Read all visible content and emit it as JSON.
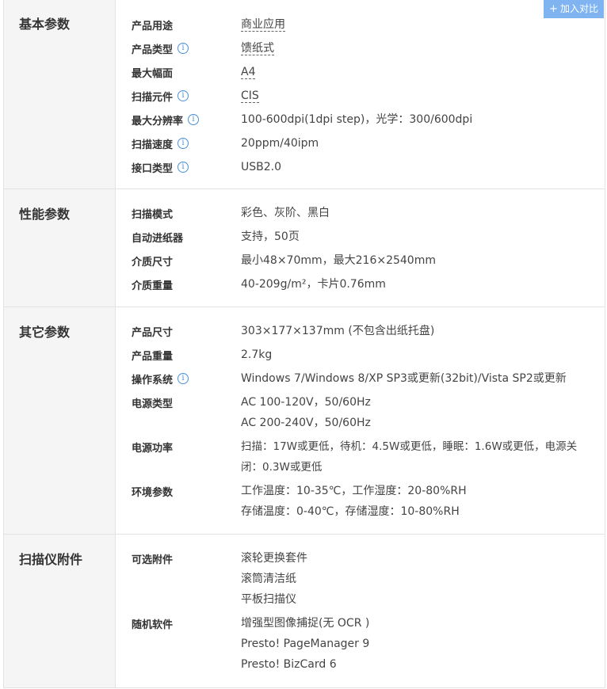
{
  "compare_button": {
    "icon": "+",
    "label": "加入对比"
  },
  "sections": [
    {
      "title": "基本参数",
      "rows": [
        {
          "label": "产品用途",
          "info": false,
          "lines": [
            "商业应用"
          ],
          "dashed": true
        },
        {
          "label": "产品类型",
          "info": true,
          "lines": [
            "馈纸式"
          ],
          "dashed": true
        },
        {
          "label": "最大幅面",
          "info": false,
          "lines": [
            "A4"
          ],
          "dashed": true
        },
        {
          "label": "扫描元件",
          "info": true,
          "lines": [
            "CIS"
          ],
          "dashed": true
        },
        {
          "label": "最大分辨率",
          "info": true,
          "lines": [
            "100-600dpi(1dpi step)，光学：300/600dpi"
          ]
        },
        {
          "label": "扫描速度",
          "info": true,
          "lines": [
            "20ppm/40ipm"
          ]
        },
        {
          "label": "接口类型",
          "info": true,
          "lines": [
            "USB2.0"
          ]
        }
      ]
    },
    {
      "title": "性能参数",
      "rows": [
        {
          "label": "扫描模式",
          "info": false,
          "lines": [
            "彩色、灰阶、黑白"
          ]
        },
        {
          "label": "自动进纸器",
          "info": false,
          "lines": [
            "支持，50页"
          ]
        },
        {
          "label": "介质尺寸",
          "info": false,
          "lines": [
            "最小48×70mm，最大216×2540mm"
          ]
        },
        {
          "label": "介质重量",
          "info": false,
          "lines": [
            "40-209g/m²，卡片0.76mm"
          ]
        }
      ]
    },
    {
      "title": "其它参数",
      "rows": [
        {
          "label": "产品尺寸",
          "info": false,
          "lines": [
            "303×177×137mm (不包含出纸托盘)"
          ]
        },
        {
          "label": "产品重量",
          "info": false,
          "lines": [
            "2.7kg"
          ]
        },
        {
          "label": "操作系统",
          "info": true,
          "lines": [
            "Windows 7/Windows 8/XP SP3或更新(32bit)/Vista SP2或更新"
          ]
        },
        {
          "label": "电源类型",
          "info": false,
          "lines": [
            "AC 100-120V，50/60Hz",
            "AC 200-240V，50/60Hz"
          ]
        },
        {
          "label": "电源功率",
          "info": false,
          "lines": [
            "扫描：17W或更低，待机：4.5W或更低，睡眠：1.6W或更低，电源关",
            "闭：0.3W或更低"
          ]
        },
        {
          "label": "环境参数",
          "info": false,
          "lines": [
            "工作温度：10-35℃，工作湿度：20-80%RH",
            "存储温度：0-40℃，存储湿度：10-80%RH"
          ]
        }
      ]
    },
    {
      "title": "扫描仪附件",
      "rows": [
        {
          "label": "可选附件",
          "info": false,
          "lines": [
            "滚轮更换套件",
            "滚筒清洁纸",
            "平板扫描仪"
          ]
        },
        {
          "label": "随机软件",
          "info": false,
          "lines": [
            "增强型图像捕捉(无 OCR )",
            "Presto! PageManager 9",
            "Presto! BizCard 6"
          ]
        }
      ]
    }
  ]
}
